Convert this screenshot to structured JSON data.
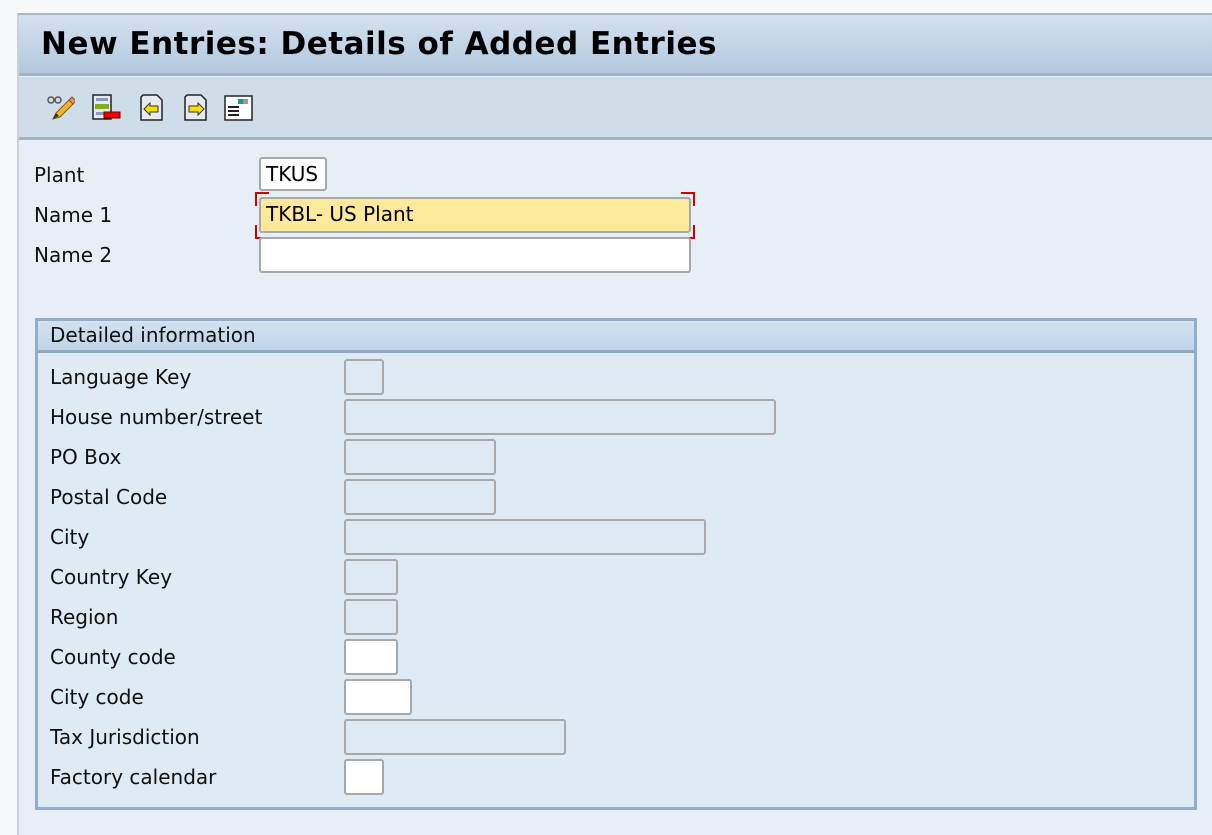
{
  "window": {
    "title": "New Entries: Details of Added Entries"
  },
  "toolbar": {
    "buttons": [
      {
        "name": "display-change-icon",
        "tooltip": "Display/Change"
      },
      {
        "name": "delete-entry-icon",
        "tooltip": "Delete"
      },
      {
        "name": "previous-entry-icon",
        "tooltip": "Previous Entry"
      },
      {
        "name": "next-entry-icon",
        "tooltip": "Next Entry"
      },
      {
        "name": "details-icon",
        "tooltip": "Details"
      }
    ]
  },
  "header_fields": {
    "plant": {
      "label": "Plant",
      "value": "TKUS"
    },
    "name1": {
      "label": "Name 1",
      "value": "TKBL- US Plant"
    },
    "name2": {
      "label": "Name 2",
      "value": ""
    }
  },
  "detail_group": {
    "title": "Detailed information",
    "fields": [
      {
        "label": "Language Key",
        "value": "",
        "editable": false
      },
      {
        "label": "House number/street",
        "value": "",
        "editable": false
      },
      {
        "label": "PO Box",
        "value": "",
        "editable": false
      },
      {
        "label": "Postal Code",
        "value": "",
        "editable": false
      },
      {
        "label": "City",
        "value": "",
        "editable": false
      },
      {
        "label": "Country Key",
        "value": "",
        "editable": false
      },
      {
        "label": "Region",
        "value": "",
        "editable": false
      },
      {
        "label": "County code",
        "value": "",
        "editable": true
      },
      {
        "label": "City code",
        "value": "",
        "editable": true
      },
      {
        "label": "Tax Jurisdiction",
        "value": "",
        "editable": false
      },
      {
        "label": "Factory calendar",
        "value": "",
        "editable": true
      }
    ]
  }
}
